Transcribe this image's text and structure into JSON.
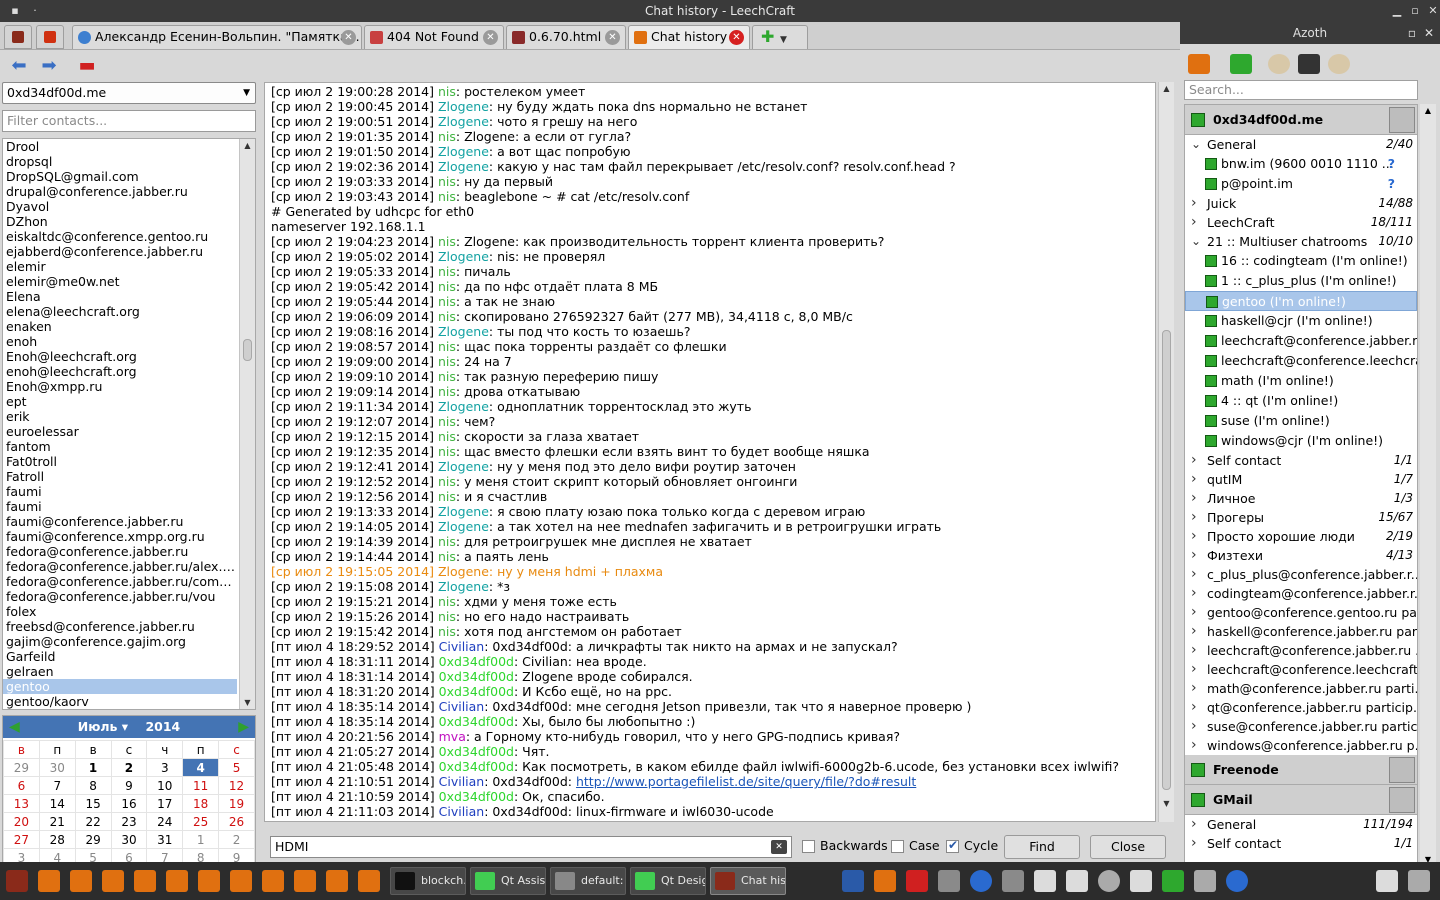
{
  "window": {
    "title": "Chat history - LeechCraft"
  },
  "tabs": [
    {
      "label": "Александр Есенин-Вольпин. \"Памятка...",
      "color": "#3d7fd0"
    },
    {
      "label": "404 Not Found",
      "color": "#c84040"
    },
    {
      "label": "0.6.70.html",
      "color": "#8a2a2a"
    },
    {
      "label": "Chat history",
      "color": "#e07010"
    }
  ],
  "account_combo": "0xd34df00d.me",
  "filter_placeholder": "Filter contacts...",
  "contacts": [
    "Drool",
    "dropsql",
    "DropSQL@gmail.com",
    "drupal@conference.jabber.ru",
    "Dyavol",
    "DZhon",
    "eiskaltdc@conference.gentoo.ru",
    "ejabberd@conference.jabber.ru",
    "elemir",
    "elemir@me0w.net",
    "Elena",
    "elena@leechcraft.org",
    "enaken",
    "enoh",
    "Enoh@leechcraft.org",
    "enoh@leechcraft.org",
    "Enoh@xmpp.ru",
    "ept",
    "erik",
    "euroelessar",
    "fantom",
    "Fat0troll",
    "Fatroll",
    "faumi",
    "faumi",
    "faumi@conference.jabber.ru",
    "faumi@conference.xmpp.org.ru",
    "fedora@conference.jabber.ru",
    "fedora@conference.jabber.ru/alex.g...",
    "fedora@conference.jabber.ru/comm...",
    "fedora@conference.jabber.ru/vou",
    "folex",
    "freebsd@conference.jabber.ru",
    "gajim@conference.gajim.org",
    "Garfeild",
    "gelraen",
    "gentoo",
    "gentoo/kaorv"
  ],
  "selected_contact": "gentoo",
  "calendar": {
    "month": "Июль",
    "year": "2014",
    "weekdays": [
      "в",
      "п",
      "в",
      "с",
      "ч",
      "п",
      "с"
    ],
    "rows": [
      [
        "29",
        "30",
        "1",
        "2",
        "3",
        "4",
        "5"
      ],
      [
        "6",
        "7",
        "8",
        "9",
        "10",
        "11",
        "12"
      ],
      [
        "13",
        "14",
        "15",
        "16",
        "17",
        "18",
        "19"
      ],
      [
        "20",
        "21",
        "22",
        "23",
        "24",
        "25",
        "26"
      ],
      [
        "27",
        "28",
        "29",
        "30",
        "31",
        "1",
        "2"
      ],
      [
        "3",
        "4",
        "5",
        "6",
        "7",
        "8",
        "9"
      ]
    ],
    "today": "4"
  },
  "chat_lines": [
    {
      "t": "[ср июл 2 19:00:28 2014] ",
      "n": "nis",
      "c": "nis",
      "m": ": ростелеком умеет"
    },
    {
      "t": "[ср июл 2 19:00:45 2014] ",
      "n": "Zlogene",
      "c": "zl",
      "m": ": ну буду ждать пока dns нормально не встанет"
    },
    {
      "t": "[ср июл 2 19:00:51 2014] ",
      "n": "Zlogene",
      "c": "zl",
      "m": ": чото я грешу на него"
    },
    {
      "t": "[ср июл 2 19:01:35 2014] ",
      "n": "nis",
      "c": "nis",
      "m": ": Zlogene: а если от гугла?"
    },
    {
      "t": "[ср июл 2 19:01:50 2014] ",
      "n": "Zlogene",
      "c": "zl",
      "m": ": а вот щас попробую"
    },
    {
      "t": "[ср июл 2 19:02:36 2014] ",
      "n": "Zlogene",
      "c": "zl",
      "m": ": какую у нас там файл перекрывает /etc/resolv.conf? resolv.conf.head ?"
    },
    {
      "t": "[ср июл 2 19:03:33 2014] ",
      "n": "nis",
      "c": "nis",
      "m": ": ну да первый"
    },
    {
      "t": "[ср июл 2 19:03:43 2014] ",
      "n": "nis",
      "c": "nis",
      "m": ": beaglebone ~ # cat /etc/resolv.conf"
    },
    {
      "t": "# Generated by udhcpc for eth0",
      "n": "",
      "c": "",
      "m": ""
    },
    {
      "t": "nameserver 192.168.1.1",
      "n": "",
      "c": "",
      "m": ""
    },
    {
      "t": "[ср июл 2 19:04:23 2014] ",
      "n": "nis",
      "c": "nis",
      "m": ": Zlogene: как производительность торрент клиента проверить?"
    },
    {
      "t": "[ср июл 2 19:05:02 2014] ",
      "n": "Zlogene",
      "c": "zl",
      "m": ": nis: не проверял"
    },
    {
      "t": "[ср июл 2 19:05:33 2014] ",
      "n": "nis",
      "c": "nis",
      "m": ": пичаль"
    },
    {
      "t": "[ср июл 2 19:05:42 2014] ",
      "n": "nis",
      "c": "nis",
      "m": ": да по нфс отдаёт плата 8 МБ"
    },
    {
      "t": "[ср июл 2 19:05:44 2014] ",
      "n": "nis",
      "c": "nis",
      "m": ": а так не знаю"
    },
    {
      "t": "[ср июл 2 19:06:09 2014] ",
      "n": "nis",
      "c": "nis",
      "m": ": скопировано 276592327 байт (277 MB), 34,4118 c, 8,0 MB/c"
    },
    {
      "t": "[ср июл 2 19:08:16 2014] ",
      "n": "Zlogene",
      "c": "zl",
      "m": ": ты под что кость то юзаешь?"
    },
    {
      "t": "[ср июл 2 19:08:57 2014] ",
      "n": "nis",
      "c": "nis",
      "m": ": щас пока торренты раздаёт со флешки"
    },
    {
      "t": "[ср июл 2 19:09:00 2014] ",
      "n": "nis",
      "c": "nis",
      "m": ": 24 на 7"
    },
    {
      "t": "[ср июл 2 19:09:10 2014] ",
      "n": "nis",
      "c": "nis",
      "m": ": так разную переферию пишу"
    },
    {
      "t": "[ср июл 2 19:09:14 2014] ",
      "n": "nis",
      "c": "nis",
      "m": ": дрова откатываю"
    },
    {
      "t": "[ср июл 2 19:11:34 2014] ",
      "n": "Zlogene",
      "c": "zl",
      "m": ": одноплатник торрентосклад это жуть"
    },
    {
      "t": "[ср июл 2 19:12:07 2014] ",
      "n": "nis",
      "c": "nis",
      "m": ": чем?"
    },
    {
      "t": "[ср июл 2 19:12:15 2014] ",
      "n": "nis",
      "c": "nis",
      "m": ": скорости за глаза хватает"
    },
    {
      "t": "[ср июл 2 19:12:35 2014] ",
      "n": "nis",
      "c": "nis",
      "m": ": щас вместо флешки если взять винт то будет вообще няшка"
    },
    {
      "t": "[ср июл 2 19:12:41 2014] ",
      "n": "Zlogene",
      "c": "zl",
      "m": ": ну у меня под это дело вифи роутир заточен"
    },
    {
      "t": "[ср июл 2 19:12:52 2014] ",
      "n": "nis",
      "c": "nis",
      "m": ": у меня стоит скрипт который обновляет онгоинги"
    },
    {
      "t": "[ср июл 2 19:12:56 2014] ",
      "n": "nis",
      "c": "nis",
      "m": ": и я счастлив"
    },
    {
      "t": "[ср июл 2 19:13:33 2014] ",
      "n": "Zlogene",
      "c": "zl",
      "m": ": я свою плату юзаю пока только когда с деревом играю"
    },
    {
      "t": "[ср июл 2 19:14:05 2014] ",
      "n": "Zlogene",
      "c": "zl",
      "m": ": а так хотел на нее mednafen зафигачить и в ретроигрушки играть"
    },
    {
      "t": "[ср июл 2 19:14:39 2014] ",
      "n": "nis",
      "c": "nis",
      "m": ": для ретроигрушек мне дисплея не хватает"
    },
    {
      "t": "[ср июл 2 19:14:44 2014] ",
      "n": "nis",
      "c": "nis",
      "m": ": а паять лень"
    },
    {
      "t": "[ср июл 2 19:15:05 2014] Zlogene: ну у меня hdmi + плахма",
      "n": "",
      "c": "hl",
      "m": ""
    },
    {
      "t": "[ср июл 2 19:15:08 2014] ",
      "n": "Zlogene",
      "c": "zl",
      "m": ": *з"
    },
    {
      "t": "[ср июл 2 19:15:21 2014] ",
      "n": "nis",
      "c": "nis",
      "m": ": хдми у меня тоже есть"
    },
    {
      "t": "[ср июл 2 19:15:26 2014] ",
      "n": "nis",
      "c": "nis",
      "m": ": но его надо настраивать"
    },
    {
      "t": "[ср июл 2 19:15:42 2014] ",
      "n": "nis",
      "c": "nis",
      "m": ": хотя под ангстемом он работает"
    },
    {
      "t": "[пт июл 4 18:29:52 2014] ",
      "n": "Civilian",
      "c": "civ",
      "m": ": 0xd34df00d: а личкрафты так никто на армах и не запускал?"
    },
    {
      "t": "[пт июл 4 18:31:11 2014] ",
      "n": "0xd34df00d",
      "c": "me",
      "m": ": Civilian: неа вроде."
    },
    {
      "t": "[пт июл 4 18:31:14 2014] ",
      "n": "0xd34df00d",
      "c": "me",
      "m": ": Zlogene вроде собирался."
    },
    {
      "t": "[пт июл 4 18:31:20 2014] ",
      "n": "0xd34df00d",
      "c": "me",
      "m": ": И Ксбо ещё, но на ppc."
    },
    {
      "t": "[пт июл 4 18:35:14 2014] ",
      "n": "Civilian",
      "c": "civ",
      "m": ": 0xd34df00d: мне сегодня Jetson привезли, так что я наверное проверю )"
    },
    {
      "t": "[пт июл 4 18:35:14 2014] ",
      "n": "0xd34df00d",
      "c": "me",
      "m": ": Хы, было бы любопытно :)"
    },
    {
      "t": "[пт июл 4 20:21:56 2014] ",
      "n": "mva",
      "c": "mva",
      "m": ": а Горному кто-нибудь говорил, что у него GPG-подпись кривая?"
    },
    {
      "t": "[пт июл 4 21:05:27 2014] ",
      "n": "0xd34df00d",
      "c": "me",
      "m": ": Чят."
    },
    {
      "t": "[пт июл 4 21:05:48 2014] ",
      "n": "0xd34df00d",
      "c": "me",
      "m": ": Как посмотреть, в каком ебилде файл iwlwifi-6000g2b-6.ucode, без установки всех iwlwifi?"
    },
    {
      "t": "[пт июл 4 21:10:51 2014] ",
      "n": "Civilian",
      "c": "civ",
      "m": ": 0xd34df00d: ",
      "l": "http://www.portagefilelist.de/site/query/file/?do#result"
    },
    {
      "t": "[пт июл 4 21:10:59 2014] ",
      "n": "0xd34df00d",
      "c": "me",
      "m": ": Ок, спасибо."
    },
    {
      "t": "[пт июл 4 21:11:03 2014] ",
      "n": "Civilian",
      "c": "civ",
      "m": ": 0xd34df00d: linux-firmware и iwl6030-ucode"
    }
  ],
  "find": {
    "value": "HDMI",
    "backwards": "Backwards",
    "case": "Case",
    "cycle": "Cycle",
    "find": "Find",
    "close": "Close"
  },
  "right": {
    "title": "Azoth",
    "search_placeholder": "Search...",
    "account1": "0xd34df00d.me",
    "general": {
      "name": "General",
      "count": "2/40"
    },
    "general_contacts": [
      "bnw.im (9600 0010 1110 ...",
      "p@point.im"
    ],
    "groups_a": [
      {
        "name": "Juick",
        "count": "14/88"
      },
      {
        "name": "LeechCraft",
        "count": "18/111"
      }
    ],
    "muc": {
      "name": "21 :: Multiuser chatrooms",
      "count": "10/10"
    },
    "muc_items": [
      "16 :: codingteam (I'm online!)",
      "1 :: c_plus_plus (I'm online!)",
      "gentoo (I'm online!)",
      "haskell@cjr (I'm online!)",
      "leechcraft@conference.jabber.r...",
      "leechcraft@conference.leechcra...",
      "math (I'm online!)",
      "4 :: qt (I'm online!)",
      "suse (I'm online!)",
      "windows@cjr (I'm online!)"
    ],
    "groups_b": [
      {
        "name": "Self contact",
        "count": "1/1"
      },
      {
        "name": "qutIM",
        "count": "1/7"
      },
      {
        "name": "Личное",
        "count": "1/3"
      },
      {
        "name": "Прогеры",
        "count": "15/67"
      },
      {
        "name": "Просто хорошие люди",
        "count": "2/19"
      },
      {
        "name": "Физтехи",
        "count": "4/13"
      }
    ],
    "rooms": [
      "c_plus_plus@conference.jabber.r...",
      "codingteam@conference.jabber.r...",
      "gentoo@conference.gentoo.ru pa...",
      "haskell@conference.jabber.ru par...",
      "leechcraft@conference.jabber.ru ...",
      "leechcraft@conference.leechcraft...",
      "math@conference.jabber.ru parti...",
      "qt@conference.jabber.ru particip...",
      "suse@conference.jabber.ru partic...",
      "windows@conference.jabber.ru p..."
    ],
    "account2": "Freenode",
    "account3": "GMail",
    "gmail_groups": [
      {
        "name": "General",
        "count": "111/194"
      },
      {
        "name": "Self contact",
        "count": "1/1"
      }
    ]
  },
  "taskbar": [
    {
      "label": "blockch...",
      "color": "#202020"
    },
    {
      "label": "Qt Assis...",
      "color": "#41cd52"
    },
    {
      "label": "default:",
      "color": "#888888"
    },
    {
      "label": "Qt Desig...",
      "color": "#41cd52"
    },
    {
      "label": "Chat his...",
      "color": "#d04010"
    }
  ],
  "colors": {
    "accent": "#4474b4",
    "online": "#2ea82e",
    "highlight": "#e88a10"
  }
}
